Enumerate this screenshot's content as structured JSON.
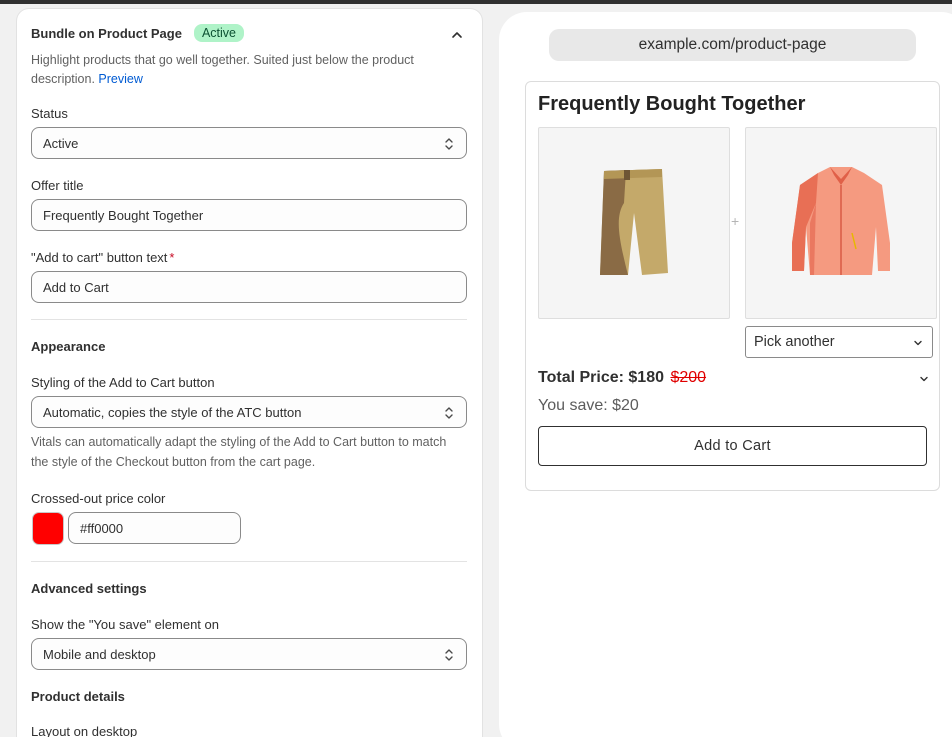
{
  "section": {
    "title": "Bundle on Product Page",
    "badge": "Active",
    "description": "Highlight products that go well together. Suited just below the product description.",
    "preview_link": "Preview"
  },
  "status": {
    "label": "Status",
    "value": "Active"
  },
  "offer_title": {
    "label": "Offer title",
    "value": "Frequently Bought Together"
  },
  "atc_text": {
    "label": "\"Add to cart\" button text",
    "required_mark": "*",
    "value": "Add to Cart"
  },
  "appearance": {
    "heading": "Appearance",
    "styling_label": "Styling of the Add to Cart button",
    "styling_value": "Automatic, copies the style of the ATC button",
    "styling_help": "Vitals can automatically adapt the styling of the Add to Cart button to match the style of the Checkout button from the cart page.",
    "crossed_label": "Crossed-out price color",
    "crossed_value": "#ff0000"
  },
  "advanced": {
    "heading": "Advanced settings",
    "you_save_label": "Show the \"You save\" element on",
    "you_save_value": "Mobile and desktop"
  },
  "product_details": {
    "heading": "Product details",
    "layout_label": "Layout on desktop"
  },
  "preview": {
    "url": "example.com/product-page",
    "widget_title": "Frequently Bought Together",
    "plus": "+",
    "pick_another": "Pick another",
    "total_label": "Total Price:",
    "total_price": "$180",
    "old_price": "$200",
    "you_save": "You save: $20",
    "atc_button": "Add to Cart",
    "product_1_icon": "shorts-icon",
    "product_2_icon": "shirt-icon"
  },
  "colors": {
    "badge_bg": "#aff3c8",
    "link": "#005bd3",
    "crossed_out": "#ff0000",
    "shorts": "#c4a96a",
    "shirt": "#f0806a"
  }
}
